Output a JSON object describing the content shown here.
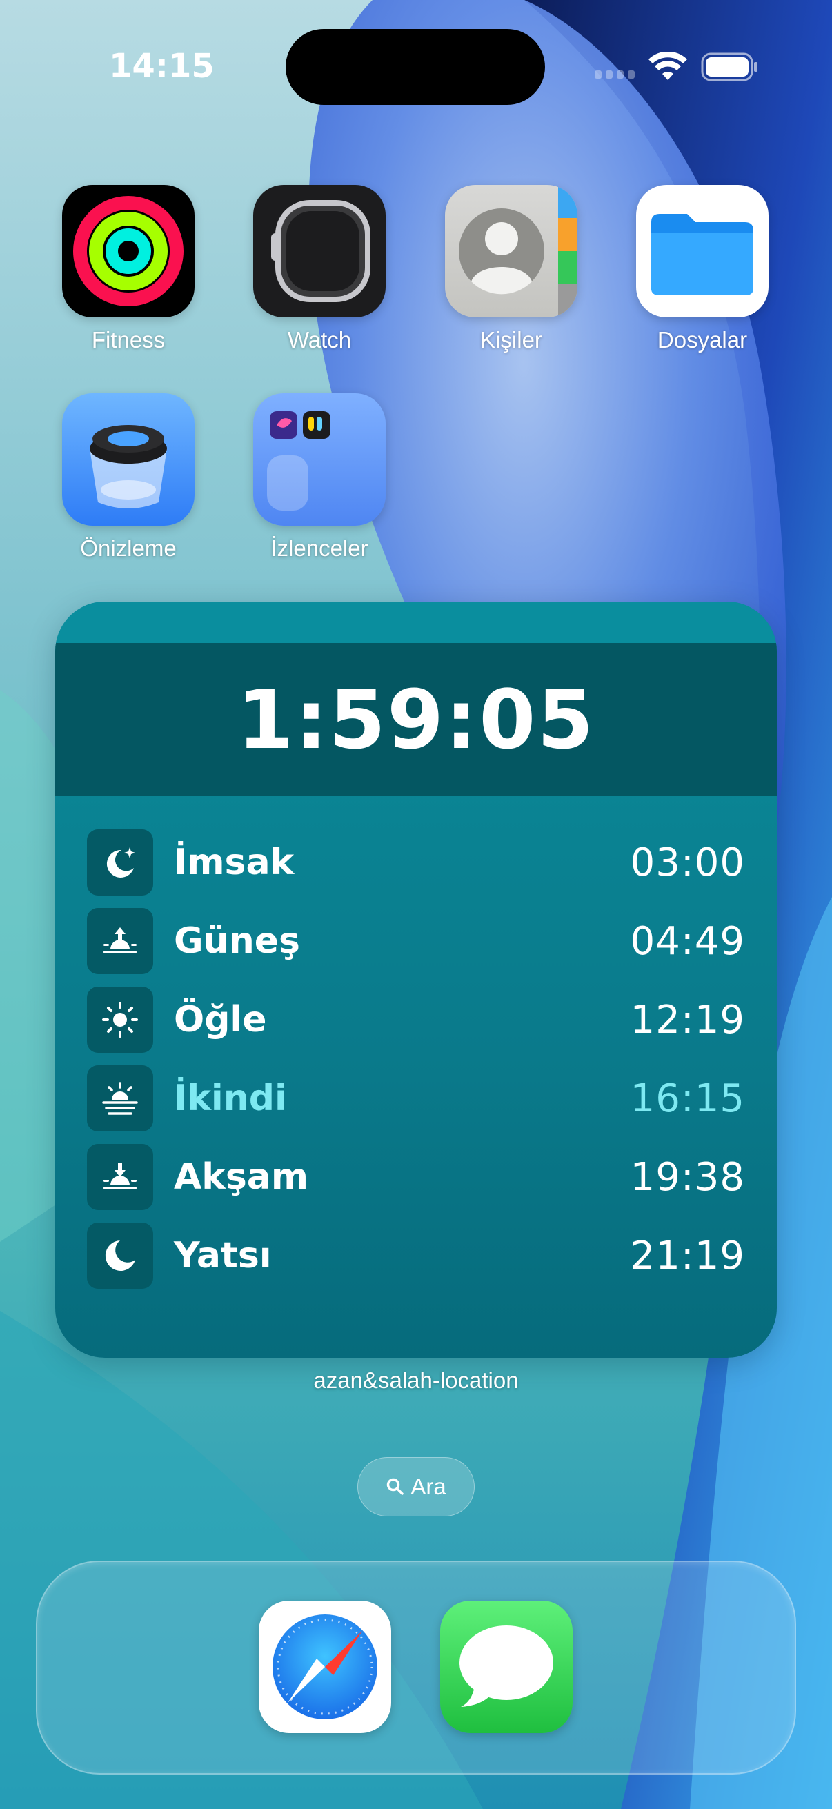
{
  "status_bar": {
    "time": "14:15",
    "icons": [
      "cellular-signal-icon",
      "wifi-icon",
      "battery-icon"
    ]
  },
  "apps": [
    {
      "label": "Fitness",
      "icon": "fitness-rings-icon"
    },
    {
      "label": "Watch",
      "icon": "watch-icon"
    },
    {
      "label": "Kişiler",
      "icon": "contacts-icon"
    },
    {
      "label": "Dosyalar",
      "icon": "folder-icon"
    },
    {
      "label": "Önizleme",
      "icon": "preview-loupe-icon"
    },
    {
      "label": "İzlenceler",
      "icon": "folder-group-icon"
    }
  ],
  "widget": {
    "countdown": "1:59:05",
    "caption": "azan&salah-location",
    "prayers": [
      {
        "name": "İmsak",
        "time": "03:00",
        "icon": "moon-stars-icon",
        "active": false
      },
      {
        "name": "Güneş",
        "time": "04:49",
        "icon": "sunrise-icon",
        "active": false
      },
      {
        "name": "Öğle",
        "time": "12:19",
        "icon": "sun-icon",
        "active": false
      },
      {
        "name": "İkindi",
        "time": "16:15",
        "icon": "sun-haze-icon",
        "active": true
      },
      {
        "name": "Akşam",
        "time": "19:38",
        "icon": "sunset-icon",
        "active": false
      },
      {
        "name": "Yatsı",
        "time": "21:19",
        "icon": "moon-icon",
        "active": false
      }
    ],
    "colors": {
      "active_text": "#7ee9f2",
      "panel": "#045762"
    }
  },
  "search": {
    "label": "Ara",
    "icon": "search-icon"
  },
  "dock": {
    "apps": [
      {
        "name": "Safari",
        "icon": "safari-compass-icon"
      },
      {
        "name": "Mesajlar",
        "icon": "messages-bubble-icon"
      }
    ]
  }
}
